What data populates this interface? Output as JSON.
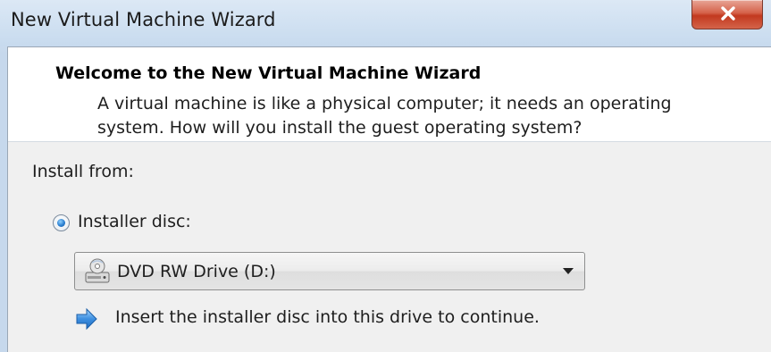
{
  "window": {
    "title": "New Virtual Machine Wizard",
    "close_icon": "close-icon"
  },
  "header": {
    "title": "Welcome to the New Virtual Machine Wizard",
    "description": "A virtual machine is like a physical computer; it needs an operating system. How will you install the guest operating system?"
  },
  "install": {
    "section_label": "Install from:",
    "option_label": "Installer disc:",
    "option_selected": true,
    "drive_select_value": "DVD RW Drive (D:)",
    "drive_icon": "dvd-drive-icon",
    "hint_icon": "arrow-right-icon",
    "hint_text": "Insert the installer disc into this drive to continue."
  },
  "colors": {
    "close_button": "#c9452b",
    "radio_selected": "#2a7fd0",
    "hint_arrow": "#3d8fe0"
  }
}
